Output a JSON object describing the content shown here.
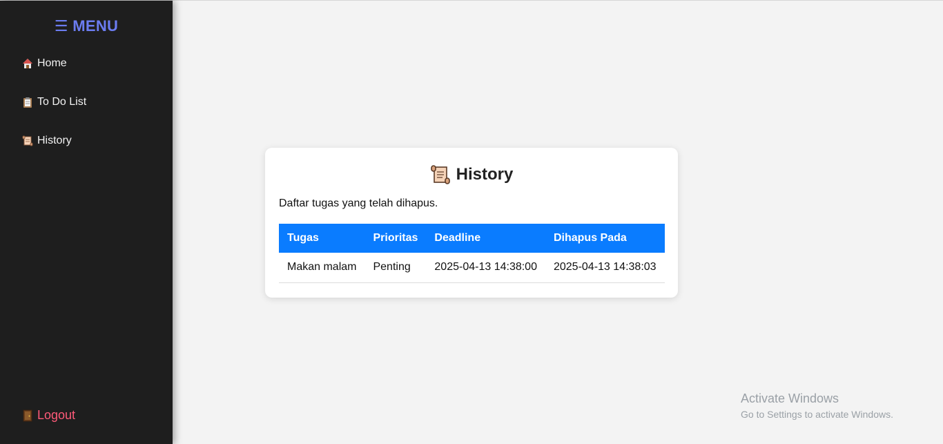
{
  "sidebar": {
    "title": "☰ MENU",
    "items": [
      {
        "label": "Home",
        "icon": "home-icon"
      },
      {
        "label": "To Do List",
        "icon": "clipboard-icon"
      },
      {
        "label": "History",
        "icon": "scroll-icon"
      }
    ],
    "logout_label": "Logout",
    "logout_icon": "door-icon"
  },
  "card": {
    "title": "History",
    "title_icon": "scroll-icon",
    "description": "Daftar tugas yang telah dihapus.",
    "table": {
      "headers": [
        "Tugas",
        "Prioritas",
        "Deadline",
        "Dihapus Pada"
      ],
      "rows": [
        [
          "Makan malam",
          "Penting",
          "2025-04-13 14:38:00",
          "2025-04-13 14:38:03"
        ]
      ]
    }
  },
  "watermark": {
    "line1": "Activate Windows",
    "line2": "Go to Settings to activate Windows."
  },
  "colors": {
    "sidebar_bg": "#1e1e1e",
    "menu_accent": "#6b7cf0",
    "logout": "#ff5a79",
    "table_header": "#0a7cff"
  }
}
